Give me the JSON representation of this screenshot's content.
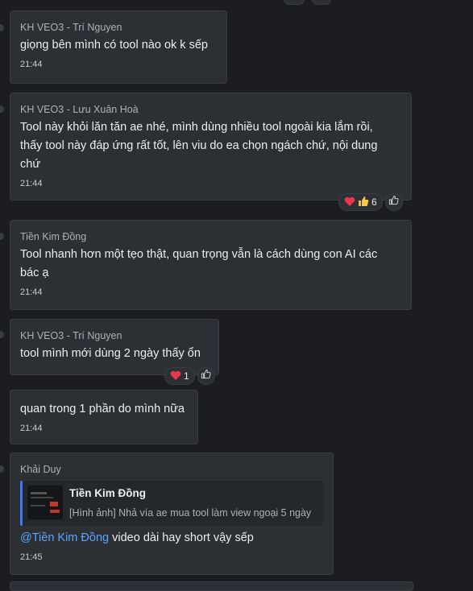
{
  "messages": [
    {
      "sender": "KH VEO3 - Trí Nguyen",
      "text": "giọng bên mình có tool nào ok k sếp",
      "time": "21:44"
    },
    {
      "sender": "KH VEO3 - Lưu Xuân Hoà",
      "text_lines": [
        "Tool này khỏi lăn tăn ae nhé, mình dùng nhiều tool ngoài kia lắm rồi,",
        "thấy tool này đáp ứng rất tốt, lên viu do ea chọn ngách chứ, nội dung",
        "chứ"
      ],
      "time": "21:44",
      "reaction_count": "6"
    },
    {
      "sender": "Tiền Kim Đồng",
      "text_lines": [
        "Tool nhanh hơn một tẹo thật, quan trọng vẫn là cách dùng con AI các",
        "bác ạ"
      ],
      "time": "21:44"
    },
    {
      "sender": "KH VEO3 - Trí Nguyen",
      "text": "tool mình mới dùng 2 ngày thấy ổn",
      "reaction_count": "1"
    },
    {
      "text": "quan trong 1 phần do mình nữa",
      "time": "21:44"
    },
    {
      "sender": "Khải Duy",
      "quote": {
        "name": "Tiền Kim Đồng",
        "snippet": "[Hình ảnh] Nhả vía ae mua tool làm view ngoại 5 ngày"
      },
      "mention": "@Tiền Kim Đồng",
      "text": " video dài hay short vậy sếp",
      "time": "21:45"
    }
  ],
  "colors": {
    "background": "#1b1d21",
    "bubble": "#2c2f34",
    "mention": "#5aa6ff",
    "quote_bar": "#3d7cf0"
  },
  "icons": {
    "heart": "heart-icon",
    "thumbs_up": "thumbs-up-icon",
    "like_outline": "like-outline-icon"
  }
}
